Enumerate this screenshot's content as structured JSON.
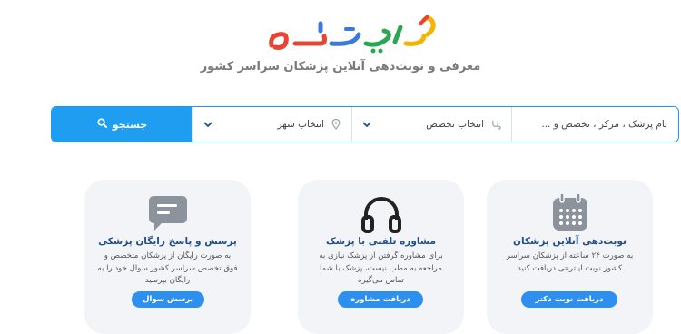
{
  "brand": {
    "logo_text": "دکتریاب",
    "tagline": "معرفی و نوبت‌دهی آنلاین پزشکان سراسر کشور",
    "colors": [
      "#e94334",
      "#3b7ad9",
      "#2aa753",
      "#f4b400"
    ]
  },
  "search": {
    "name_placeholder": "نام پزشک ، مرکز ، تخصص و ...",
    "specialty_label": "انتخاب تخصص",
    "city_label": "انتخاب شهر",
    "button_label": "جستجو",
    "accent": "#1e9df1"
  },
  "cards": [
    {
      "icon": "calendar-icon",
      "title": "نوبت‌دهی آنلاین پزشکان",
      "description": "به صورت ۲۴ ساعته از پزشکان سراسر کشور نوبت اینترنتی دریافت کنید",
      "button": "دریافت نوبت دکتر"
    },
    {
      "icon": "headphones-icon",
      "title": "مشاوره تلفنی با پزشک",
      "description": "برای مشاوره گرفتن از پزشک نیازی به مراجعه به مطب نیست، پزشک با شما تماس می‌گیره",
      "button": "دریافت مشاوره"
    },
    {
      "icon": "chat-icon",
      "title": "پرسش و پاسخ رایگان پزشکی",
      "description": "به صورت رایگان از پزشکان متخصص و فوق تخصص سراسر کشور سوال خود را به رایگان بپرسید",
      "button": "پرسش سوال"
    }
  ]
}
